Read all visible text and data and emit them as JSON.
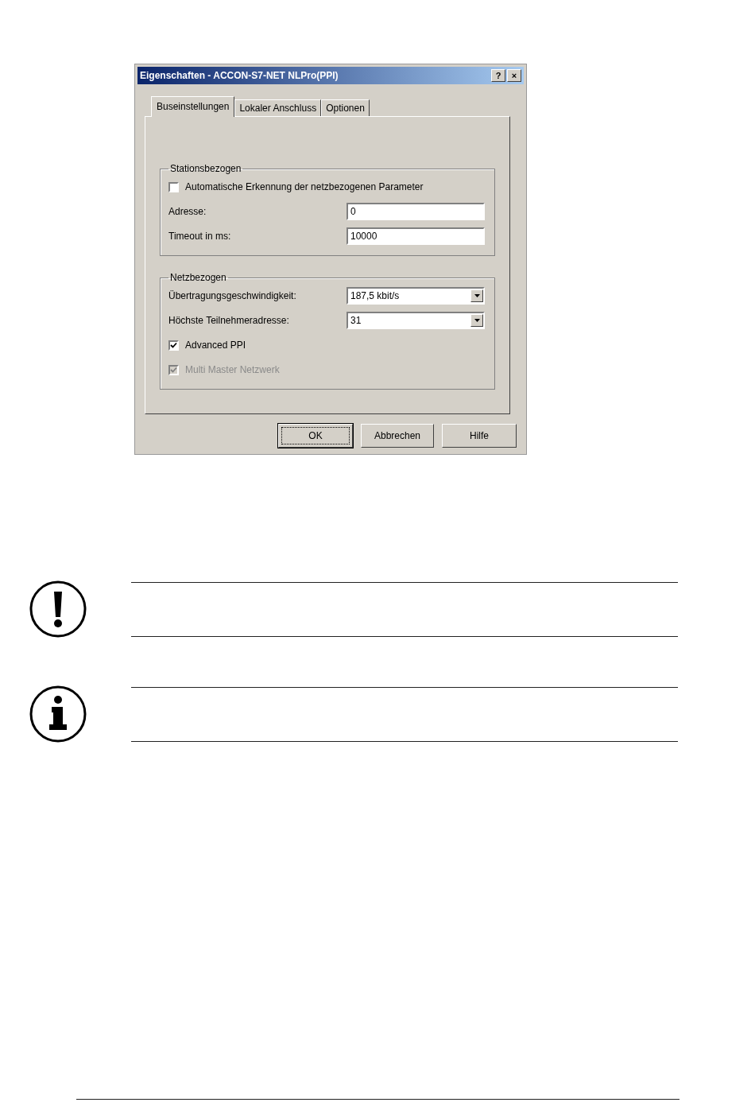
{
  "window": {
    "title": "Eigenschaften - ACCON-S7-NET NLPro(PPI)",
    "title_buttons": [
      "?",
      "×"
    ]
  },
  "tabs": [
    {
      "label": "Buseinstellungen",
      "selected": true
    },
    {
      "label": "Lokaler Anschluss",
      "selected": false
    },
    {
      "label": "Optionen",
      "selected": false
    }
  ],
  "groups": [
    {
      "title": "Stationsbezogen",
      "items": [
        {
          "kind": "checkbox",
          "label": "Automatische Erkennung der netzbezogenen Parameter",
          "checked": false,
          "disabled": false
        },
        {
          "kind": "text",
          "label": "Adresse:",
          "value": "0"
        },
        {
          "kind": "text",
          "label": "Timeout in ms:",
          "value": "10000"
        }
      ]
    },
    {
      "title": "Netzbezogen",
      "items": [
        {
          "kind": "select",
          "label": "Übertragungsgeschwindigkeit:",
          "value": "187,5 kbit/s"
        },
        {
          "kind": "select",
          "label": "Höchste Teilnehmeradresse:",
          "value": "31"
        },
        {
          "kind": "checkbox",
          "label": "Advanced PPI",
          "checked": true,
          "disabled": false
        },
        {
          "kind": "checkbox",
          "label": "Multi Master Netzwerk",
          "checked": true,
          "disabled": true
        }
      ]
    }
  ],
  "buttons": [
    {
      "label": "OK",
      "focused": true
    },
    {
      "label": "Abbrechen",
      "focused": false
    },
    {
      "label": "Hilfe",
      "focused": false
    }
  ],
  "notes": [
    {
      "kind": "warning"
    },
    {
      "kind": "info"
    }
  ]
}
